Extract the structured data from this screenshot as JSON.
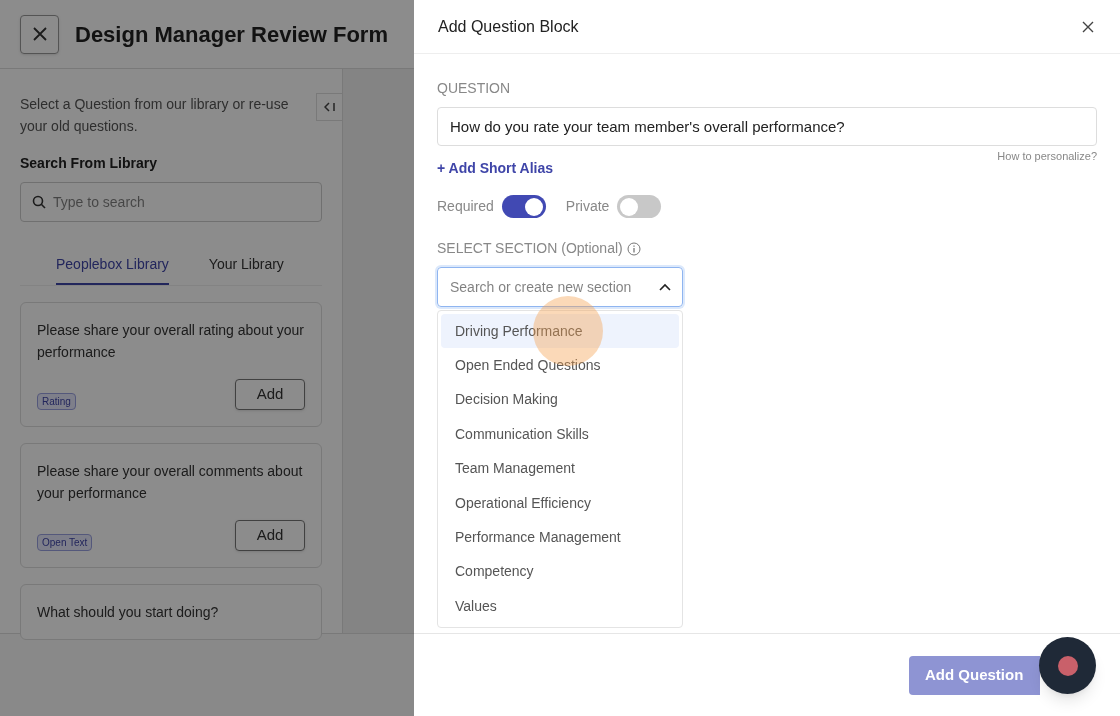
{
  "page": {
    "title": "Design Manager Review Form",
    "intro": "Select a Question from our library or re-use your old questions.",
    "search_label": "Search From Library",
    "search": {
      "placeholder": "Type to search"
    },
    "tabs": [
      {
        "label": "Peoplebox Library",
        "selected": true
      },
      {
        "label": "Your Library",
        "selected": false
      }
    ],
    "questions": [
      {
        "text": "Please share your overall rating about your performance",
        "tag": "Rating",
        "button": "Add"
      },
      {
        "text": "Please share your overall comments about your performance",
        "tag": "Open Text",
        "button": "Add"
      },
      {
        "text": "What should you start doing?"
      }
    ]
  },
  "drawer": {
    "title": "Add Question Block",
    "question_label": "QUESTION",
    "question": {
      "value": "How do you rate your team member's overall performance?"
    },
    "personalize_link": "How to personalize?",
    "alias_link": "+ Add Short Alias",
    "toggles": [
      {
        "label": "Required",
        "on": true
      },
      {
        "label": "Private",
        "on": false
      }
    ],
    "section_label": "SELECT SECTION (Optional)",
    "section": {
      "placeholder": "Search or create new section",
      "expanded": true
    },
    "options": [
      {
        "label": "Driving Performance",
        "selected": true
      },
      {
        "label": "Open Ended Questions",
        "selected": false
      },
      {
        "label": "Decision Making",
        "selected": false
      },
      {
        "label": "Communication Skills",
        "selected": false
      },
      {
        "label": "Team Management",
        "selected": false
      },
      {
        "label": "Operational Efficiency",
        "selected": false
      },
      {
        "label": "Performance Management",
        "selected": false
      },
      {
        "label": "Competency",
        "selected": false
      },
      {
        "label": "Values",
        "selected": false
      }
    ],
    "submit": "Add Question"
  }
}
